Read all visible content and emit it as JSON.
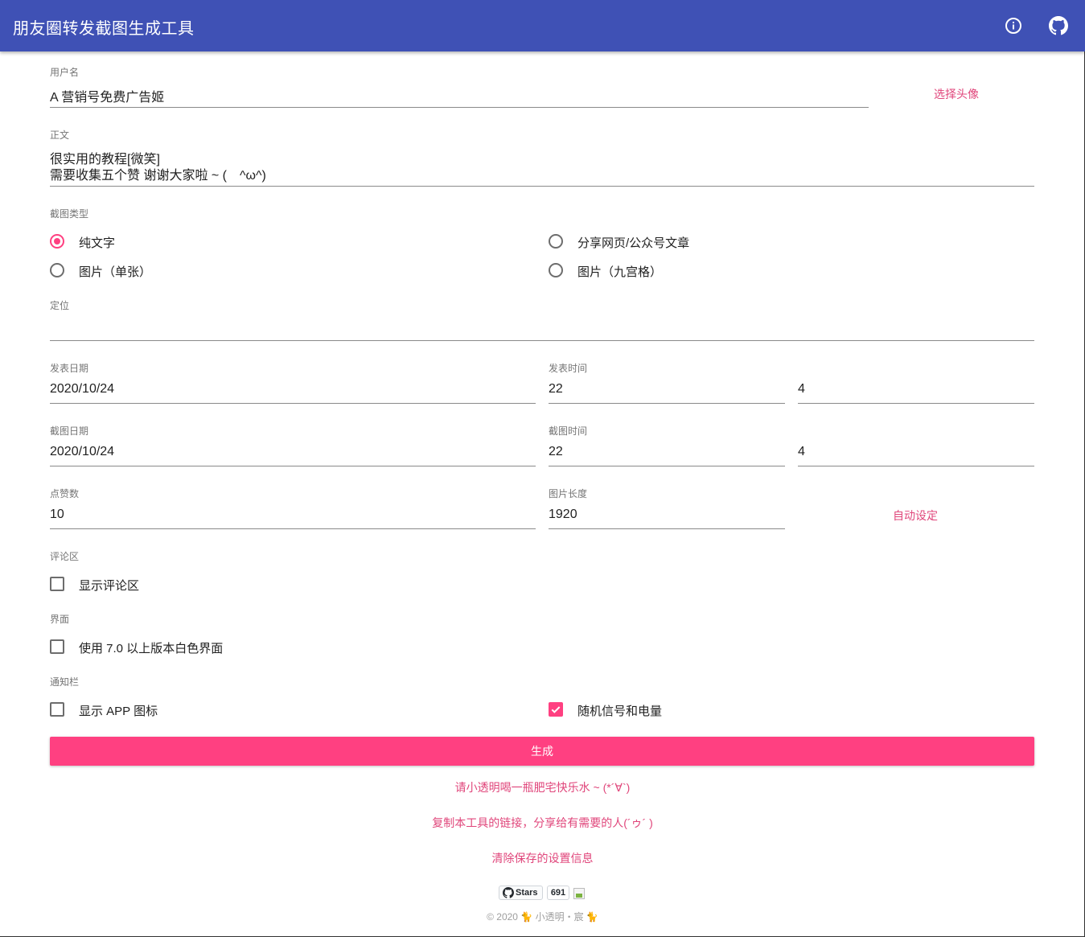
{
  "appbar": {
    "title": "朋友圈转发截图生成工具",
    "info_icon": "info-icon",
    "github_icon": "github-icon"
  },
  "username": {
    "label": "用户名",
    "value": "A 营销号免费广告姬",
    "avatar_link": "选择头像"
  },
  "body": {
    "label": "正文",
    "line1": "很实用的教程[微笑]",
    "line2": "需要收集五个赞 谢谢大家啦 ~ (　^ω^)"
  },
  "screenshot_type": {
    "label": "截图类型",
    "options": [
      {
        "label": "纯文字",
        "checked": true
      },
      {
        "label": "分享网页/公众号文章",
        "checked": false
      },
      {
        "label": "图片（单张）",
        "checked": false
      },
      {
        "label": "图片（九宫格）",
        "checked": false
      }
    ]
  },
  "location": {
    "label": "定位",
    "value": ""
  },
  "publish": {
    "date_label": "发表日期",
    "date_value": "2020/10/24",
    "time_label": "发表时间",
    "hour": "22",
    "minute": "4"
  },
  "capture": {
    "date_label": "截图日期",
    "date_value": "2020/10/24",
    "time_label": "截图时间",
    "hour": "22",
    "minute": "4"
  },
  "likes": {
    "label": "点赞数",
    "value": "10"
  },
  "image_length": {
    "label": "图片长度",
    "value": "1920",
    "auto_link": "自动设定"
  },
  "comments": {
    "label": "评论区",
    "option": "显示评论区",
    "checked": false
  },
  "interface": {
    "label": "界面",
    "option": "使用 7.0 以上版本白色界面",
    "checked": false
  },
  "notification": {
    "label": "通知栏",
    "app_icon_option": "显示 APP 图标",
    "app_icon_checked": false,
    "signal_option": "随机信号和电量",
    "signal_checked": true
  },
  "generate_button": "生成",
  "links": {
    "donate": "请小透明喝一瓶肥宅快乐水 ~ (*´∀`)",
    "share": "复制本工具的链接，分享给有需要的人(´ゥ´ )",
    "clear": "清除保存的设置信息"
  },
  "github_badge": {
    "label": "Stars",
    "count": "691"
  },
  "footer": "© 2020 🐈 小透明・宸 🐈",
  "colors": {
    "primary": "#3f51b5",
    "accent": "#ff4081",
    "link": "#e0467b"
  }
}
